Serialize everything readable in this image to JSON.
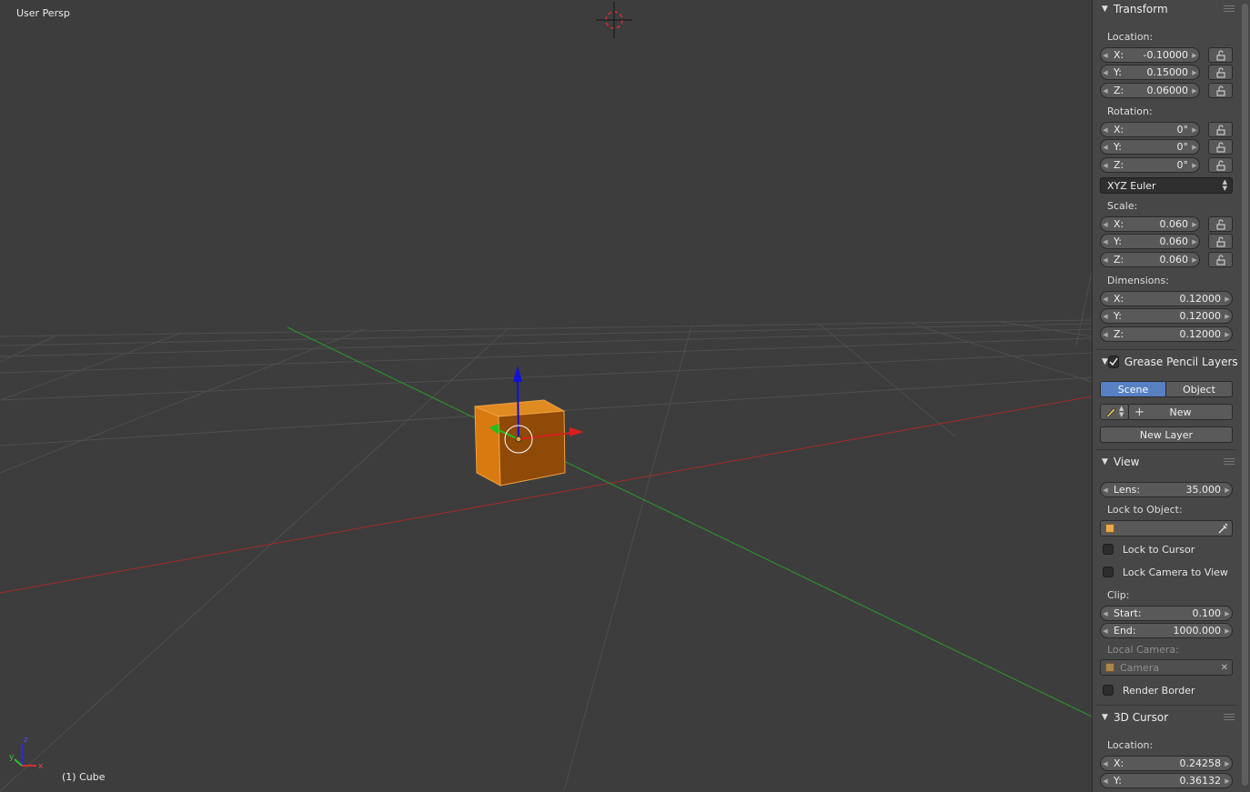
{
  "viewport": {
    "view_label": "User Persp",
    "object_label": "(1) Cube",
    "axis_x": "x",
    "axis_y": "y",
    "axis_z": "z"
  },
  "colors": {
    "selected_object": "#e07f16",
    "x_axis": "#b01e1e",
    "y_axis": "#1f9a1f",
    "z_axis": "#1010d8",
    "active_tab": "#5680c2"
  },
  "transform": {
    "title": "Transform",
    "location_label": "Location:",
    "location": [
      {
        "axis": "X:",
        "value": "-0.10000"
      },
      {
        "axis": "Y:",
        "value": "0.15000"
      },
      {
        "axis": "Z:",
        "value": "0.06000"
      }
    ],
    "rotation_label": "Rotation:",
    "rotation": [
      {
        "axis": "X:",
        "value": "0°"
      },
      {
        "axis": "Y:",
        "value": "0°"
      },
      {
        "axis": "Z:",
        "value": "0°"
      }
    ],
    "rotation_mode": "XYZ Euler",
    "scale_label": "Scale:",
    "scale": [
      {
        "axis": "X:",
        "value": "0.060"
      },
      {
        "axis": "Y:",
        "value": "0.060"
      },
      {
        "axis": "Z:",
        "value": "0.060"
      }
    ],
    "dimensions_label": "Dimensions:",
    "dimensions": [
      {
        "axis": "X:",
        "value": "0.12000"
      },
      {
        "axis": "Y:",
        "value": "0.12000"
      },
      {
        "axis": "Z:",
        "value": "0.12000"
      }
    ]
  },
  "grease_pencil": {
    "title": "Grease Pencil Layers",
    "enabled": true,
    "tab_scene": "Scene",
    "tab_object": "Object",
    "active_tab": "Scene",
    "new_label": "New",
    "new_layer_label": "New Layer"
  },
  "view": {
    "title": "View",
    "lens_label": "Lens:",
    "lens_value": "35.000",
    "lock_to_object_label": "Lock to Object:",
    "lock_to_cursor": "Lock to Cursor",
    "lock_camera_to_view": "Lock Camera to View",
    "clip_label": "Clip:",
    "clip_start_label": "Start:",
    "clip_start": "0.100",
    "clip_end_label": "End:",
    "clip_end": "1000.000",
    "local_camera_label": "Local Camera:",
    "local_camera_value": "Camera",
    "render_border": "Render Border"
  },
  "cursor_3d": {
    "title": "3D Cursor",
    "location_label": "Location:",
    "location": [
      {
        "axis": "X:",
        "value": "0.24258"
      },
      {
        "axis": "Y:",
        "value": "0.36132"
      }
    ]
  }
}
